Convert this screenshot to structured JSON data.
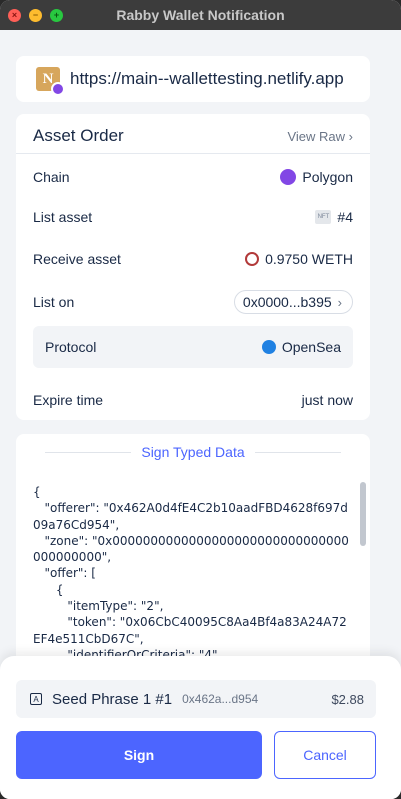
{
  "window": {
    "title": "Rabby Wallet Notification",
    "controls": {
      "close": "×",
      "minimize": "−",
      "zoom": "+"
    }
  },
  "origin": {
    "logo_letter": "N",
    "url": "https://main--wallettesting.netlify.app"
  },
  "asset_order": {
    "title": "Asset Order",
    "view_raw_label": "View Raw",
    "rows": {
      "chain": {
        "label": "Chain",
        "value": "Polygon"
      },
      "list_asset": {
        "label": "List asset",
        "badge": "NFT",
        "value": "#4"
      },
      "receive_asset": {
        "label": "Receive asset",
        "value": "0.9750 WETH"
      },
      "list_on": {
        "label": "List on",
        "value": "0x0000...b395"
      },
      "protocol": {
        "label": "Protocol",
        "value": "OpenSea"
      },
      "expire_time": {
        "label": "Expire time",
        "value": "just now"
      }
    }
  },
  "sign_typed_data": {
    "title": "Sign Typed Data",
    "code": "{\n   \"offerer\": \"0x462A0d4fE4C2b10aadFBD4628f697d09a76Cd954\",\n   \"zone\": \"0x0000000000000000000000000000000000000000\",\n   \"offer\": [\n      {\n         \"itemType\": \"2\",\n         \"token\": \"0x06CbC40095C8Aa4Bf4a83A24A72EF4e511CbD67C\",\n         \"identifierOrCriteria\": \"4\","
  },
  "account": {
    "icon_letter": "A",
    "name": "Seed Phrase 1 #1",
    "address": "0x462a...d954",
    "balance": "$2.88"
  },
  "actions": {
    "sign_label": "Sign",
    "cancel_label": "Cancel"
  },
  "colors": {
    "accent": "#4c65ff",
    "polygon": "#8247e5",
    "opensea": "#2081e2"
  }
}
